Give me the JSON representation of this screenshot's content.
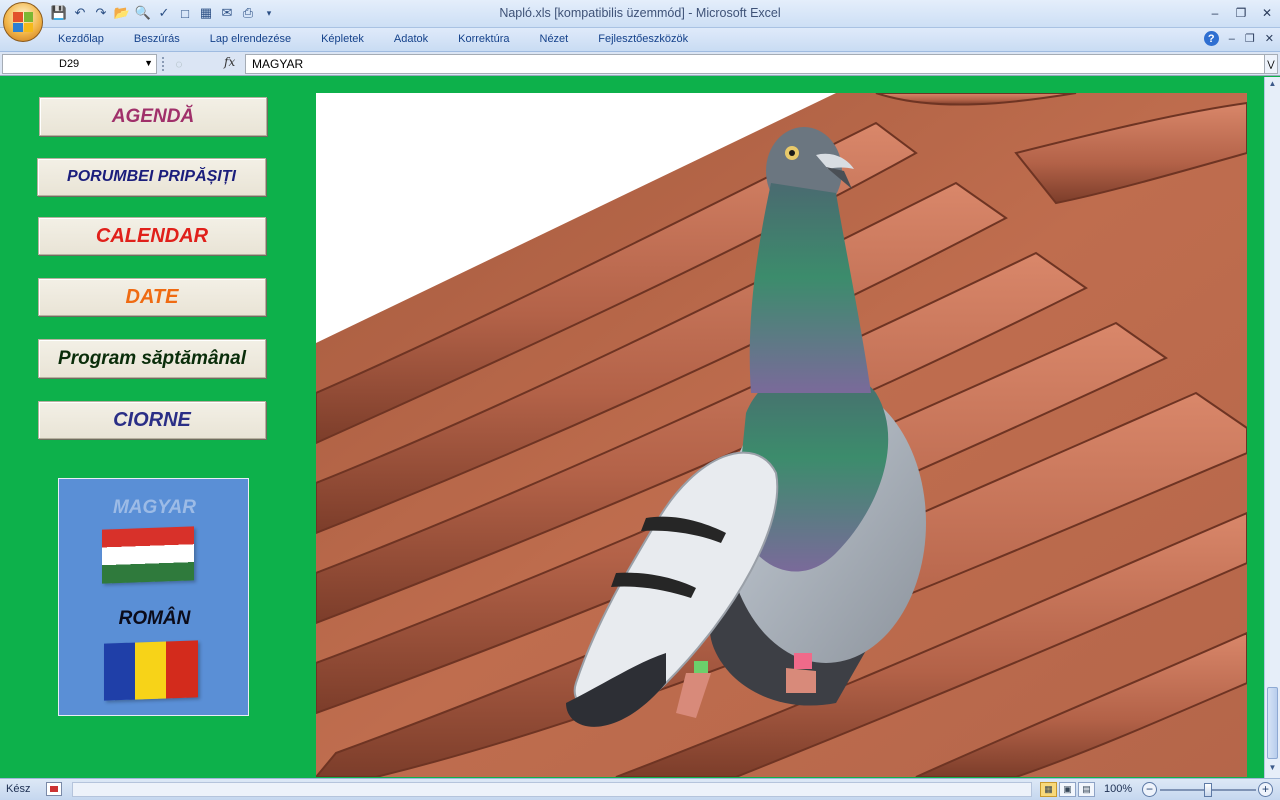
{
  "window": {
    "title": "Napló.xls  [kompatibilis üzemmód] - Microsoft Excel"
  },
  "ribbon": {
    "tabs": [
      "Kezdőlap",
      "Beszúrás",
      "Lap elrendezése",
      "Képletek",
      "Adatok",
      "Korrektúra",
      "Nézet",
      "Fejlesztőeszközök"
    ]
  },
  "formula_bar": {
    "cell_ref": "D29",
    "formula": "MAGYAR",
    "fx_label": "fx"
  },
  "sheet": {
    "buttons": {
      "agenda": "AGENDĂ",
      "porumbei": "PORUMBEI PRIPĂȘIȚI",
      "calendar": "CALENDAR",
      "date": "DATE",
      "program": "Program săptămânal",
      "ciorne": "CIORNE"
    },
    "language": {
      "hungarian": "MAGYAR",
      "romanian": "ROMÂN"
    }
  },
  "status_bar": {
    "ready": "Kész",
    "zoom": "100%"
  },
  "colors": {
    "sheet_background": "#0db14b",
    "language_panel": "#5a8fd6",
    "agenda_text": "#a0306a",
    "calendar_text": "#e0201a",
    "date_text": "#ef6b12"
  },
  "icons": {
    "office_button": "office-logo-icon",
    "hungarian_flag": "hungary-flag-icon",
    "romanian_flag": "romania-flag-icon"
  }
}
